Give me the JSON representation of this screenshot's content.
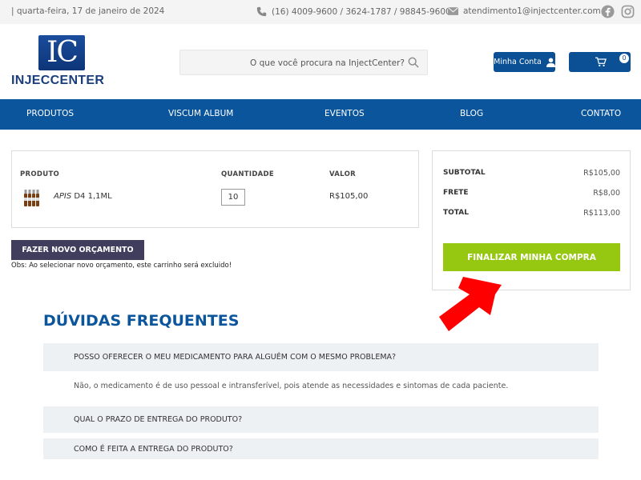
{
  "topbar": {
    "date": "| quarta-feira, 17 de janeiro de 2024",
    "phone": "(16) 4009-9600 / 3624-1787 / 98845-9600",
    "email": "atendimento1@injectcenter.com.br",
    "icons": [
      "phone-icon",
      "mail-icon",
      "facebook-icon",
      "instagram-icon"
    ]
  },
  "header": {
    "logo_mark": "IC",
    "logo_text": "INJECCENTER",
    "search_placeholder": "O que você procura na InjectCenter?",
    "account_label": "Minha Conta",
    "cart_count": "0"
  },
  "nav": {
    "items": [
      "PRODUTOS",
      "VISCUM ALBUM",
      "EVENTOS",
      "BLOG",
      "CONTATO"
    ]
  },
  "cart": {
    "headers": {
      "product": "PRODUTO",
      "quantity": "QUANTIDADE",
      "value": "VALOR"
    },
    "item": {
      "name_italic": "APIS",
      "name_rest": " D4 1,1ML",
      "quantity": "10",
      "price": "R$105,00"
    }
  },
  "actions": {
    "new_quote": "FAZER NOVO ORÇAMENTO",
    "note": "Obs: Ao selecionar novo orçamento, este carrinho será excluido!"
  },
  "summary": {
    "subtotal_label": "SUBTOTAL",
    "subtotal": "R$105,00",
    "shipping_label": "FRETE",
    "shipping": "R$8,00",
    "total_label": "TOTAL",
    "total": "R$113,00",
    "finish": "FINALIZAR MINHA COMPRA"
  },
  "faq": {
    "title": "DÚVIDAS FREQUENTES",
    "items": [
      {
        "q": "POSSO OFERECER O MEU MEDICAMENTO PARA ALGUÉM COM O MESMO PROBLEMA?",
        "a": "Não, o medicamento é de uso pessoal e intransferível, pois atende as necessidades e sintomas de cada paciente."
      },
      {
        "q": "QUAL O PRAZO DE ENTREGA DO PRODUTO?"
      },
      {
        "q": "COMO É FEITA A ENTREGA DO PRODUTO?"
      }
    ]
  },
  "colors": {
    "brand_blue": "#0b559d",
    "button_green": "#96c812",
    "quote_button": "#403e5c",
    "arrow_red": "#ff0000"
  }
}
